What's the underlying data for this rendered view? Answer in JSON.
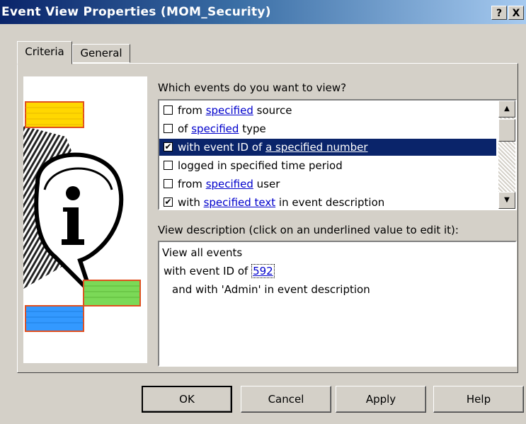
{
  "window": {
    "title": "Event View Properties (MOM_Security)",
    "help_glyph": "?",
    "close_glyph": "X"
  },
  "tabs": [
    {
      "label": "Criteria",
      "active": true
    },
    {
      "label": "General",
      "active": false
    }
  ],
  "criteria": {
    "question_label": "Which events do you want to view?",
    "items": [
      {
        "checked": false,
        "selected": false,
        "pre": "from ",
        "link": "specified",
        "post": " source"
      },
      {
        "checked": false,
        "selected": false,
        "pre": "of ",
        "link": "specified",
        "post": " type"
      },
      {
        "checked": true,
        "selected": true,
        "pre": "with event ID of ",
        "link": "a specified number",
        "post": ""
      },
      {
        "checked": false,
        "selected": false,
        "pre": "logged in specified time period",
        "link": "",
        "post": ""
      },
      {
        "checked": false,
        "selected": false,
        "pre": "from ",
        "link": "specified",
        "post": " user"
      },
      {
        "checked": true,
        "selected": false,
        "pre": "with ",
        "link": "specified text",
        "post": " in event description"
      }
    ],
    "description_label": "View description (click on an underlined value to edit it):",
    "description": {
      "line1": "View all events",
      "line2_pre": "with event ID of ",
      "line2_link": "592",
      "line3": "and with 'Admin' in event description"
    }
  },
  "buttons": {
    "ok": "OK",
    "cancel": "Cancel",
    "apply": "Apply",
    "help": "Help"
  },
  "colors": {
    "selection": "#0a246a",
    "link": "#0000cc",
    "yellow_block": "#ffd700",
    "green_block": "#7bd957",
    "blue_block": "#3399ff",
    "block_border": "#e05020"
  }
}
